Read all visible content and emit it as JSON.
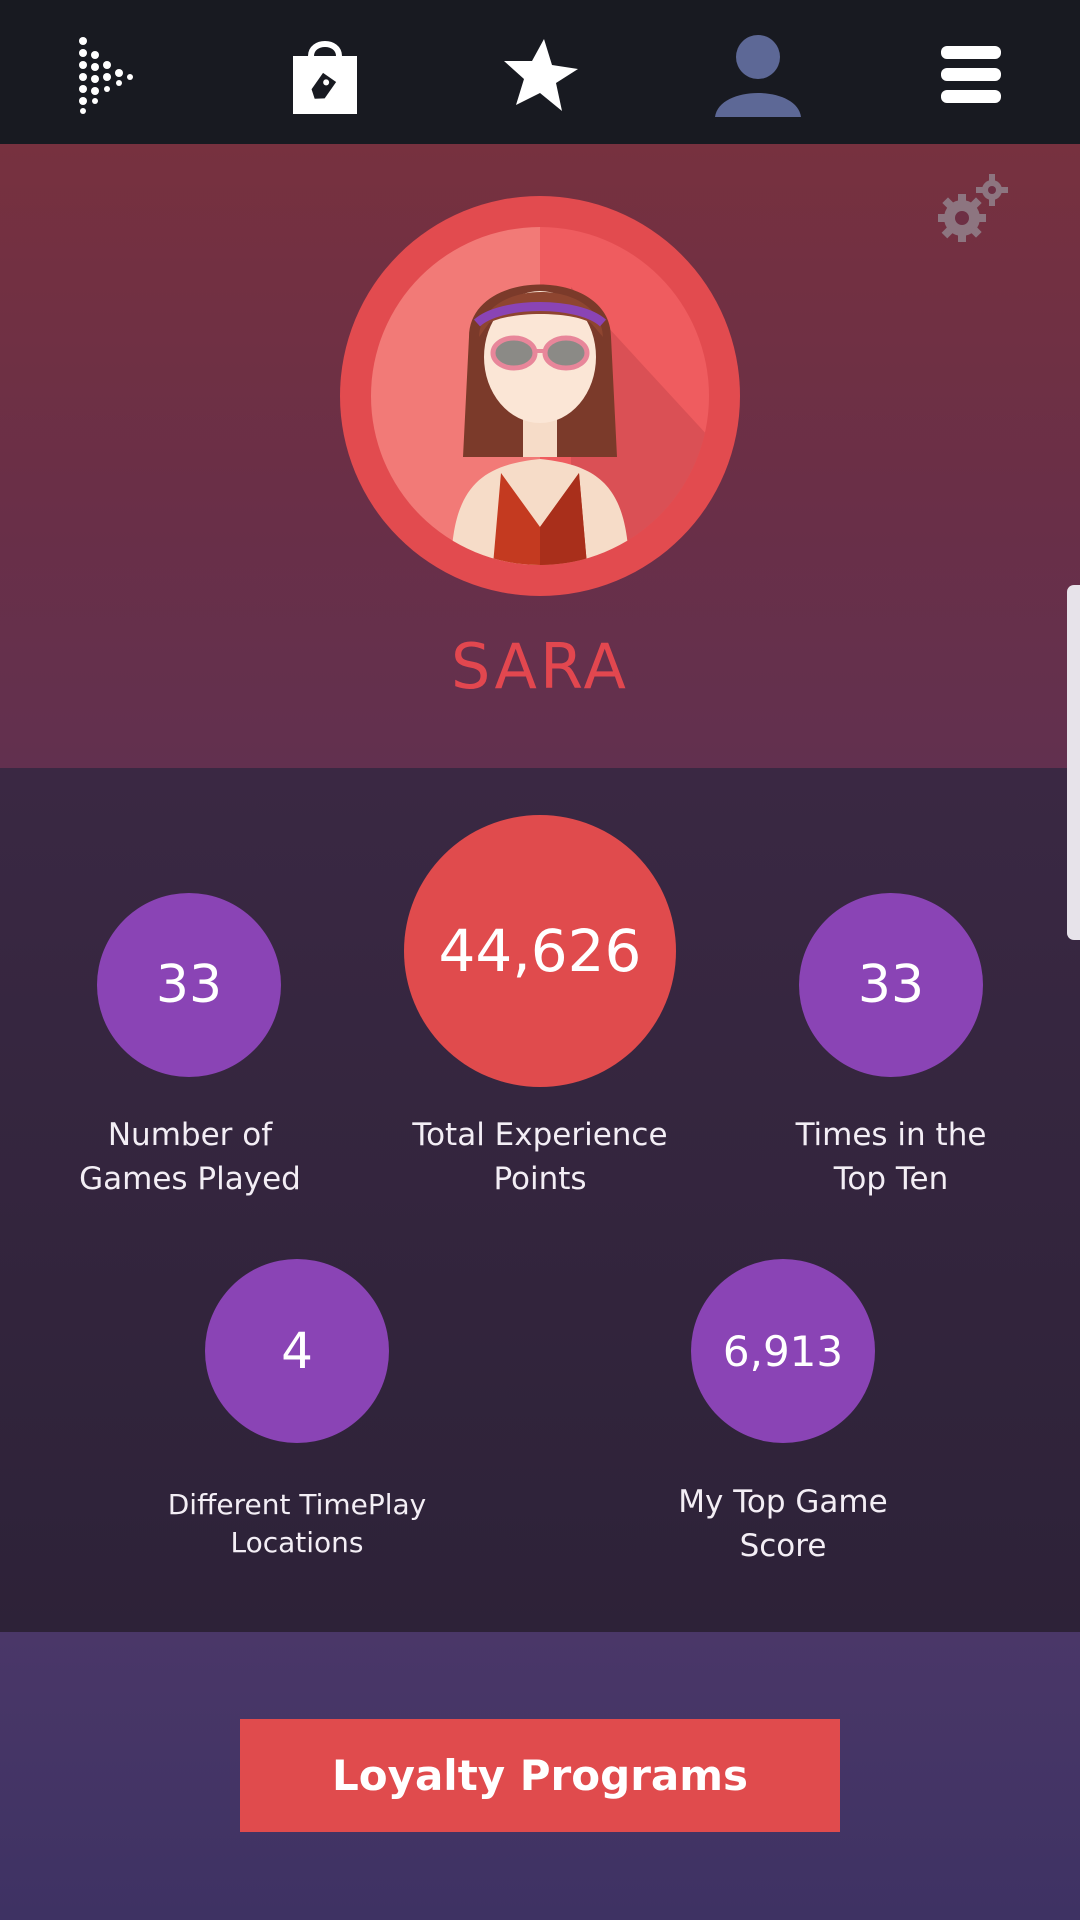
{
  "nav": {
    "icons": [
      "timeplay-logo-icon",
      "shopping-bag-icon",
      "star-icon",
      "user-icon",
      "menu-icon"
    ]
  },
  "profile": {
    "name": "SARA",
    "settings_icon": "gears-icon"
  },
  "stats": {
    "games_played": {
      "value": "33",
      "label_line1": "Number of",
      "label_line2": "Games Played"
    },
    "experience_points": {
      "value": "44,626",
      "label_line1": "Total Experience",
      "label_line2": "Points"
    },
    "top_ten": {
      "value": "33",
      "label_line1": "Times in the",
      "label_line2": "Top Ten"
    },
    "locations": {
      "value": "4",
      "label_line1": "Different TimePlay",
      "label_line2": "Locations"
    },
    "top_score": {
      "value": "6,913",
      "label_line1": "My Top Game",
      "label_line2": "Score"
    }
  },
  "footer": {
    "button_label": "Loyalty Programs"
  },
  "colors": {
    "topbar": "#181a21",
    "accent_red": "#e04b4d",
    "stat_purple": "#8a44b5",
    "name_red": "#e2474f"
  }
}
